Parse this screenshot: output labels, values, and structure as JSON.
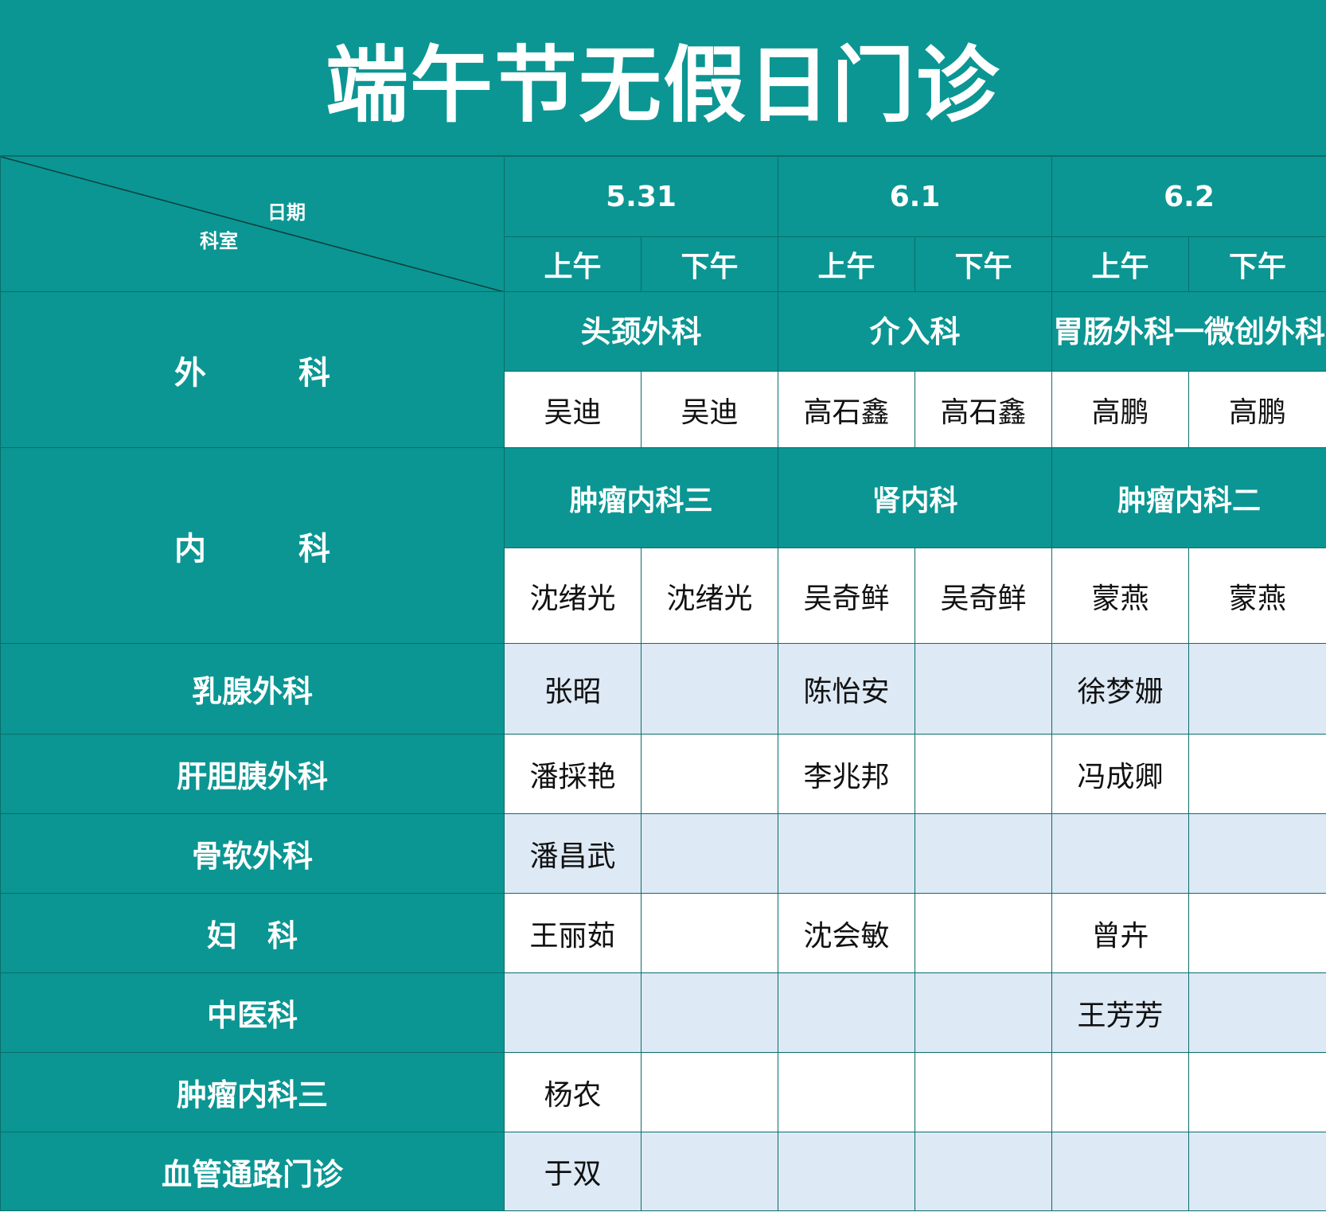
{
  "title": "端午节无假日门诊",
  "corner": {
    "top_label": "日期",
    "bottom_label": "科室"
  },
  "dates": [
    "5.31",
    "6.1",
    "6.2"
  ],
  "periods": [
    "上午",
    "下午",
    "上午",
    "下午",
    "上午",
    "下午"
  ],
  "surgery": {
    "label": "外　科",
    "sub_departments": [
      "头颈外科",
      "介入科",
      "胃肠外科一微创外科"
    ],
    "doctors": [
      "吴迪",
      "吴迪",
      "高石鑫",
      "高石鑫",
      "高鹏",
      "高鹏"
    ]
  },
  "internal": {
    "label": "内　科",
    "sub_departments": [
      "肿瘤内科三",
      "肾内科",
      "肿瘤内科二"
    ],
    "doctors": [
      "沈绪光",
      "沈绪光",
      "吴奇鲜",
      "吴奇鲜",
      "蒙燕",
      "蒙燕"
    ]
  },
  "rows": [
    {
      "dept": "乳腺外科",
      "cells": [
        "张昭",
        "",
        "陈怡安",
        "",
        "徐梦姗",
        ""
      ]
    },
    {
      "dept": "肝胆胰外科",
      "cells": [
        "潘採艳",
        "",
        "李兆邦",
        "",
        "冯成卿",
        ""
      ]
    },
    {
      "dept": "骨软外科",
      "cells": [
        "潘昌武",
        "",
        "",
        "",
        "",
        ""
      ]
    },
    {
      "dept": "妇　科",
      "cells": [
        "王丽茹",
        "",
        "沈会敏",
        "",
        "曾卉",
        ""
      ]
    },
    {
      "dept": "中医科",
      "cells": [
        "",
        "",
        "",
        "",
        "王芳芳",
        ""
      ]
    },
    {
      "dept": "肿瘤内科三",
      "cells": [
        "杨农",
        "",
        "",
        "",
        "",
        ""
      ]
    },
    {
      "dept": "血管通路门诊",
      "cells": [
        "于双",
        "",
        "",
        "",
        "",
        ""
      ]
    }
  ],
  "colors": {
    "teal": "#0b9693",
    "light_blue": "#dde9f5",
    "white": "#ffffff"
  }
}
